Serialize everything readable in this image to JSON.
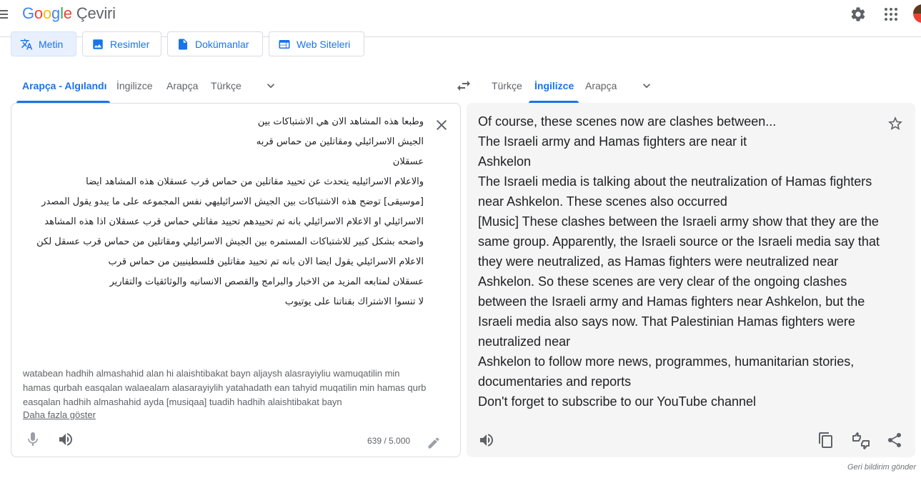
{
  "app": {
    "logo_letters": [
      "G",
      "o",
      "o",
      "g",
      "l",
      "e"
    ],
    "product": "Çeviri"
  },
  "modes": [
    {
      "label": "Metin",
      "icon": "translate-icon",
      "active": true
    },
    {
      "label": "Resimler",
      "icon": "image-icon",
      "active": false
    },
    {
      "label": "Dokümanlar",
      "icon": "document-icon",
      "active": false
    },
    {
      "label": "Web Siteleri",
      "icon": "web-icon",
      "active": false
    }
  ],
  "source_langs": [
    "Arapça - Algılandı",
    "İngilizce",
    "Arapça",
    "Türkçe"
  ],
  "target_langs": [
    "Türkçe",
    "İngilizce",
    "Arapça"
  ],
  "source": {
    "lines": [
      "وطبعا هذه المشاهد الان هي الاشتباكات بين",
      "الجيش الاسرائيلي ومقاتلين من حماس قربه",
      "عسقلان",
      "والاعلام الاسرائيليه يتحدث عن تحييد مقاتلين من حماس قرب عسقلان هذه المشاهد ايضا",
      "[موسيقى] توضح هذه الاشتباكات بين الجيش الاسرائيليهي نفس المجموعه على ما يبدو يقول المصدر",
      "الاسرائيلي او الاعلام الاسرائيلي بانه تم تحييدهم تحييد مقاتلي حماس قرب عسقلان اذا هذه المشاهد",
      "واضحه بشكل كبير للاشتباكات المستمره بين الجيش الاسرائيلي ومقاتلين من حماس قرب عسقل لكن",
      "الاعلام الاسرائيلي يقول ايضا الان بانه تم تحييد مقاتلين فلسطينيين من حماس قرب",
      "عسقلان لمتابعه المزيد من الاخبار والبرامج والقصص الانسانيه والوثائقيات والتقارير",
      "لا تنسوا الاشتراك بقناتنا على يوتيوب"
    ],
    "transliteration": "watabean hadhih almashahid alan hi alaishtibakat bayn aljaysh alasrayiyliu wamuqatilin min hamas qurbah easqalan walaealam alasarayiylih yatahadath ean tahyid muqatilin min hamas qurb easqalan hadhih almashahid ayda [musiqaa] tuadih hadhih alaishtibakat bayn",
    "show_more": "Daha fazla göster",
    "char_count": "639 / 5.000"
  },
  "target": {
    "lines": [
      "Of course, these scenes now are clashes between...",
      "The Israeli army and Hamas fighters are near it",
      "Ashkelon",
      "The Israeli media is talking about the neutralization of Hamas fighters",
      "near Ashkelon. These scenes also occurred",
      "[Music] These clashes between the Israeli army show that they are the",
      "same group. Apparently, the Israeli source or the Israeli media say that",
      "they were neutralized, as Hamas fighters were neutralized near",
      "Ashkelon. So these scenes are very clear of the ongoing clashes",
      "between the Israeli army and Hamas fighters near Ashkelon, but the",
      "Israeli media also says now. That Palestinian Hamas fighters were",
      "neutralized near",
      "Ashkelon to follow more news, programmes, humanitarian stories,",
      "documentaries and reports",
      "Don't forget to subscribe to our YouTube channel"
    ]
  },
  "feedback": "Geri bildirim gönder",
  "colors": {
    "accent": "#1a73e8",
    "panel_bg": "#f5f5f5",
    "border": "#dadce0"
  }
}
